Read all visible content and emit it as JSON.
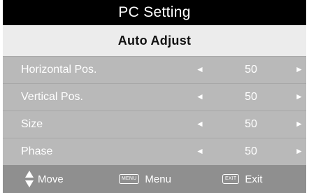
{
  "menu": {
    "title": "PC Setting",
    "selected_item": "Auto  Adjust",
    "items": [
      {
        "label": "Horizontal  Pos.",
        "value": "50"
      },
      {
        "label": "Vertical Pos.",
        "value": "50"
      },
      {
        "label": "Size",
        "value": "50"
      },
      {
        "label": "Phase",
        "value": "50"
      }
    ],
    "left_arrow": "◄",
    "right_arrow": "►"
  },
  "footer": {
    "move_label": "Move",
    "menu_key": "MENU",
    "menu_label": "Menu",
    "exit_key": "EXIT",
    "exit_label": "Exit"
  },
  "colors": {
    "title_bg": "#000000",
    "selected_bg": "#ececec",
    "row_bg": "#b9b9b9",
    "footer_bg": "#8f8f8f"
  }
}
